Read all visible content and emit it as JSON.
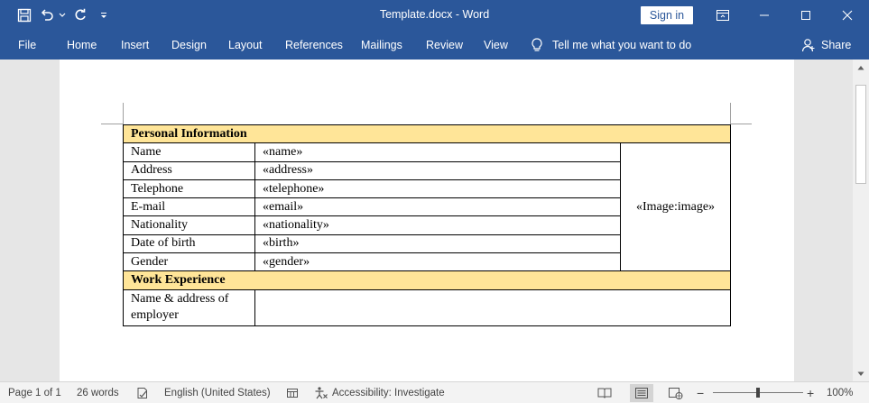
{
  "window": {
    "title": "Template.docx  -  Word",
    "sign_in_label": "Sign in"
  },
  "ribbon": {
    "tabs": [
      "File",
      "Home",
      "Insert",
      "Design",
      "Layout",
      "References",
      "Mailings",
      "Review",
      "View"
    ],
    "tell_me": "Tell me what you want to do",
    "share": "Share"
  },
  "document": {
    "personal_header": "Personal Information",
    "rows": [
      {
        "label": "Name",
        "value": "«name»"
      },
      {
        "label": "Address",
        "value": "«address»"
      },
      {
        "label": "Telephone",
        "value": "«telephone»"
      },
      {
        "label": "E-mail",
        "value": "«email»"
      },
      {
        "label": "Nationality",
        "value": "«nationality»"
      },
      {
        "label": "Date of birth",
        "value": "«birth»"
      },
      {
        "label": "Gender",
        "value": "«gender»"
      }
    ],
    "image_field": "«Image:image»",
    "work_header": "Work Experience",
    "employer_label": "Name & address of employer"
  },
  "status_bar": {
    "page": "Page 1 of 1",
    "words": "26 words",
    "language": "English (United States)",
    "accessibility": "Accessibility: Investigate",
    "zoom": "100%"
  },
  "colors": {
    "accent": "#2b579a",
    "section_fill": "#ffe598"
  },
  "icons": [
    "save-icon",
    "undo-icon",
    "redo-icon",
    "customize-qat-icon",
    "ribbon-display-icon",
    "minimize-icon",
    "maximize-icon",
    "close-icon",
    "lightbulb-icon",
    "share-person-icon",
    "proofing-icon",
    "macro-icon",
    "accessibility-icon",
    "read-mode-icon",
    "print-layout-icon",
    "web-layout-icon"
  ]
}
